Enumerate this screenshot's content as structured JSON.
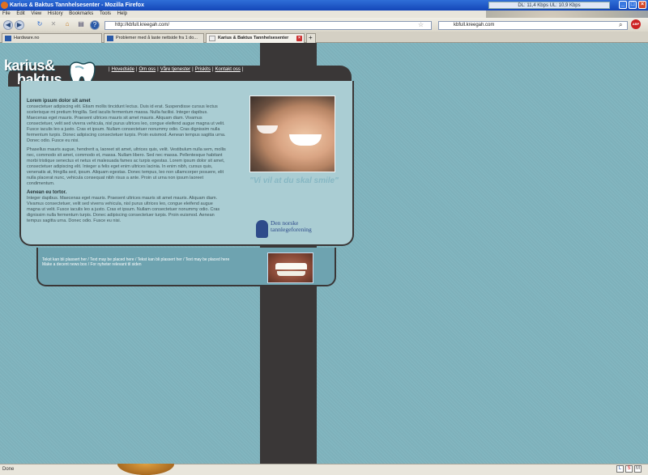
{
  "browser": {
    "window_title": "Karius & Baktus Tannhelsesenter - Mozilla Firefox",
    "net_meter": "DL: 11,4 Kbps UL: 10,9 Kbps",
    "menu": [
      "File",
      "Edit",
      "View",
      "History",
      "Bookmarks",
      "Tools",
      "Help"
    ],
    "url": "http://kbfull.kreegah.com/",
    "search_value": "kbfull.kreegah.com",
    "tabs": [
      {
        "label": "Hardware.no"
      },
      {
        "label": "Problemer med å laste nettside fra 1 do..."
      },
      {
        "label": "Karius & Baktus Tannhelsesenter"
      }
    ],
    "status": "Done"
  },
  "site": {
    "logo": {
      "line1": "karius&",
      "line2": "baktus"
    },
    "nav": [
      "Hovedside",
      "Om oss",
      "Våre tjenester",
      "Priskits",
      "Kontakt oss"
    ],
    "sections": [
      {
        "heading": "Lorem ipsum dolor sit amet",
        "body": "consectetuer adipiscing elit. Etiam mollis tincidunt lectus. Duis id erat. Suspendisse cursus lectus scelerisque mi pretium fringilla. Sed iaculis fermentum massa. Nulla facilisi. Integer dapibus. Maecenas eget mauris. Praesent ultrices mauris sit amet mauris. Aliquam diam. Vivamus consectetuer, velit sed viverra vehicula, nisl purus ultrices leo, congue eleifend augue magna ut velit. Fusce iaculis leo a justo. Cras et ipsum. Nullam consectetuer nonummy odio. Cras dignissim nulla fermentum turpis. Donec adipiscing consectetuer turpis. Proin euismod. Aenean tempus sagitta urna. Donec odio. Fusce eu nisi."
      },
      {
        "heading": "",
        "body": "Phasellus mauris augue, hendrerit a, laoreet sit amet, ultrices quis, velit. Vestibulum nulla sem, mollis nec, commodo sit amet, commodo et, massa. Nullam libero. Sed nec massa. Pellentesque habitant morbi tristique senectus et netus et malesuada fames ac turpis egestas. Lorem ipsum dolor sit amet, consectetuer adipiscing elit. Integer a felis eget enim ultrices lacinia. In enim nibh, cursus quis, venenatis at, fringilla sed, ipsum. Aliquam egestas. Donec tempus, leo non ullamcorper posuere, elit nulla placerat nunc, vehicula consequat nibh risus a ante. Proin ut urna non ipsum laoreet condimentum."
      },
      {
        "heading": "Aenean eu tortor.",
        "body": "Integer dapibus. Maecenas eget mauris. Praesent ultrices mauris sit amet mauris. Aliquam diam. Vivamus consectetuer, velit sed viverra vehicula, nisl purus ultrices leo, congue eleifend augue magna ut velit. Fusce iaculis leo a justo. Cras et ipsum. Nullam consectetuer nonummy odio. Cras dignissim nulla fermentum turpis. Donec adipiscing consectetuer turpis. Proin euismod. Aenean tempus sagitta urna. Donec odio. Fusce eu nisi."
      }
    ],
    "slogan": "\"Vi vil at du skal smile\"",
    "nto": {
      "line1": "Den norske",
      "line2": "tannlegeforening"
    },
    "footer_lines": [
      "Tekst kan bli plassert her / Text may be placed here / Tekst kan bli plassert her / Text may be placed here",
      "Make a decent news box / For nyheter relevant til siden"
    ]
  },
  "colors": {
    "dark": "#3a3737",
    "panel": "#aacdd3",
    "bg": "#7fb3bd",
    "accent": "#86b7c3"
  }
}
